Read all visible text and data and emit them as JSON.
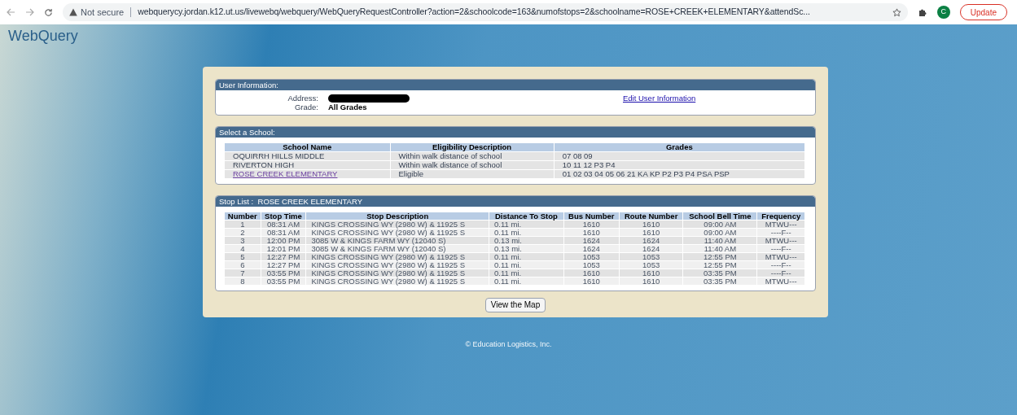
{
  "browser": {
    "security": "Not secure",
    "url": "webquerycy.jordan.k12.ut.us/livewebq/webquery/WebQueryRequestController?action=2&schoolcode=163&numofstops=2&schoolname=ROSE+CREEK+ELEMENTARY&attendSc...",
    "profile": "C",
    "update": "Update"
  },
  "site_title": "WebQuery",
  "user_info": {
    "title": "User Information:",
    "address_label": "Address:",
    "grade_label": "Grade:",
    "grade": "All Grades",
    "edit_link": "Edit User Information"
  },
  "schools": {
    "title": "Select a School:",
    "columns": [
      "School Name",
      "Eligibility Description",
      "Grades"
    ],
    "rows": [
      {
        "name": "OQUIRRH HILLS MIDDLE",
        "eligibility": "Within walk distance of school",
        "grades": "07 08 09",
        "link": false
      },
      {
        "name": "RIVERTON HIGH",
        "eligibility": "Within walk distance of school",
        "grades": "10 11 12 P3 P4",
        "link": false
      },
      {
        "name": "ROSE CREEK ELEMENTARY",
        "eligibility": "Eligible",
        "grades": "01 02 03 04 05 06 21 KA KP P2 P3 P4 PSA PSP",
        "link": true
      }
    ]
  },
  "stops": {
    "title": "Stop List :  ROSE CREEK ELEMENTARY",
    "columns": [
      "Number",
      "Stop Time",
      "Stop Description",
      "Distance To Stop",
      "Bus Number",
      "Route Number",
      "School Bell Time",
      "Frequency"
    ],
    "rows": [
      [
        "1",
        "08:31 AM",
        "KINGS CROSSING WY (2980 W) & 11925 S",
        "0.11 mi.",
        "1610",
        "1610",
        "09:00 AM",
        "MTWU---"
      ],
      [
        "2",
        "08:31 AM",
        "KINGS CROSSING WY (2980 W) & 11925 S",
        "0.11 mi.",
        "1610",
        "1610",
        "09:00 AM",
        "----F--"
      ],
      [
        "3",
        "12:00 PM",
        "3085 W & KINGS FARM WY (12040 S)",
        "0.13 mi.",
        "1624",
        "1624",
        "11:40 AM",
        "MTWU---"
      ],
      [
        "4",
        "12:01 PM",
        "3085 W & KINGS FARM WY (12040 S)",
        "0.13 mi.",
        "1624",
        "1624",
        "11:40 AM",
        "----F--"
      ],
      [
        "5",
        "12:27 PM",
        "KINGS CROSSING WY (2980 W) & 11925 S",
        "0.11 mi.",
        "1053",
        "1053",
        "12:55 PM",
        "MTWU---"
      ],
      [
        "6",
        "12:27 PM",
        "KINGS CROSSING WY (2980 W) & 11925 S",
        "0.11 mi.",
        "1053",
        "1053",
        "12:55 PM",
        "----F--"
      ],
      [
        "7",
        "03:55 PM",
        "KINGS CROSSING WY (2980 W) & 11925 S",
        "0.11 mi.",
        "1610",
        "1610",
        "03:35 PM",
        "----F--"
      ],
      [
        "8",
        "03:55 PM",
        "KINGS CROSSING WY (2980 W) & 11925 S",
        "0.11 mi.",
        "1610",
        "1610",
        "03:35 PM",
        "MTWU---"
      ]
    ]
  },
  "map_button": "View the Map",
  "footer": "© Education Logistics, Inc."
}
